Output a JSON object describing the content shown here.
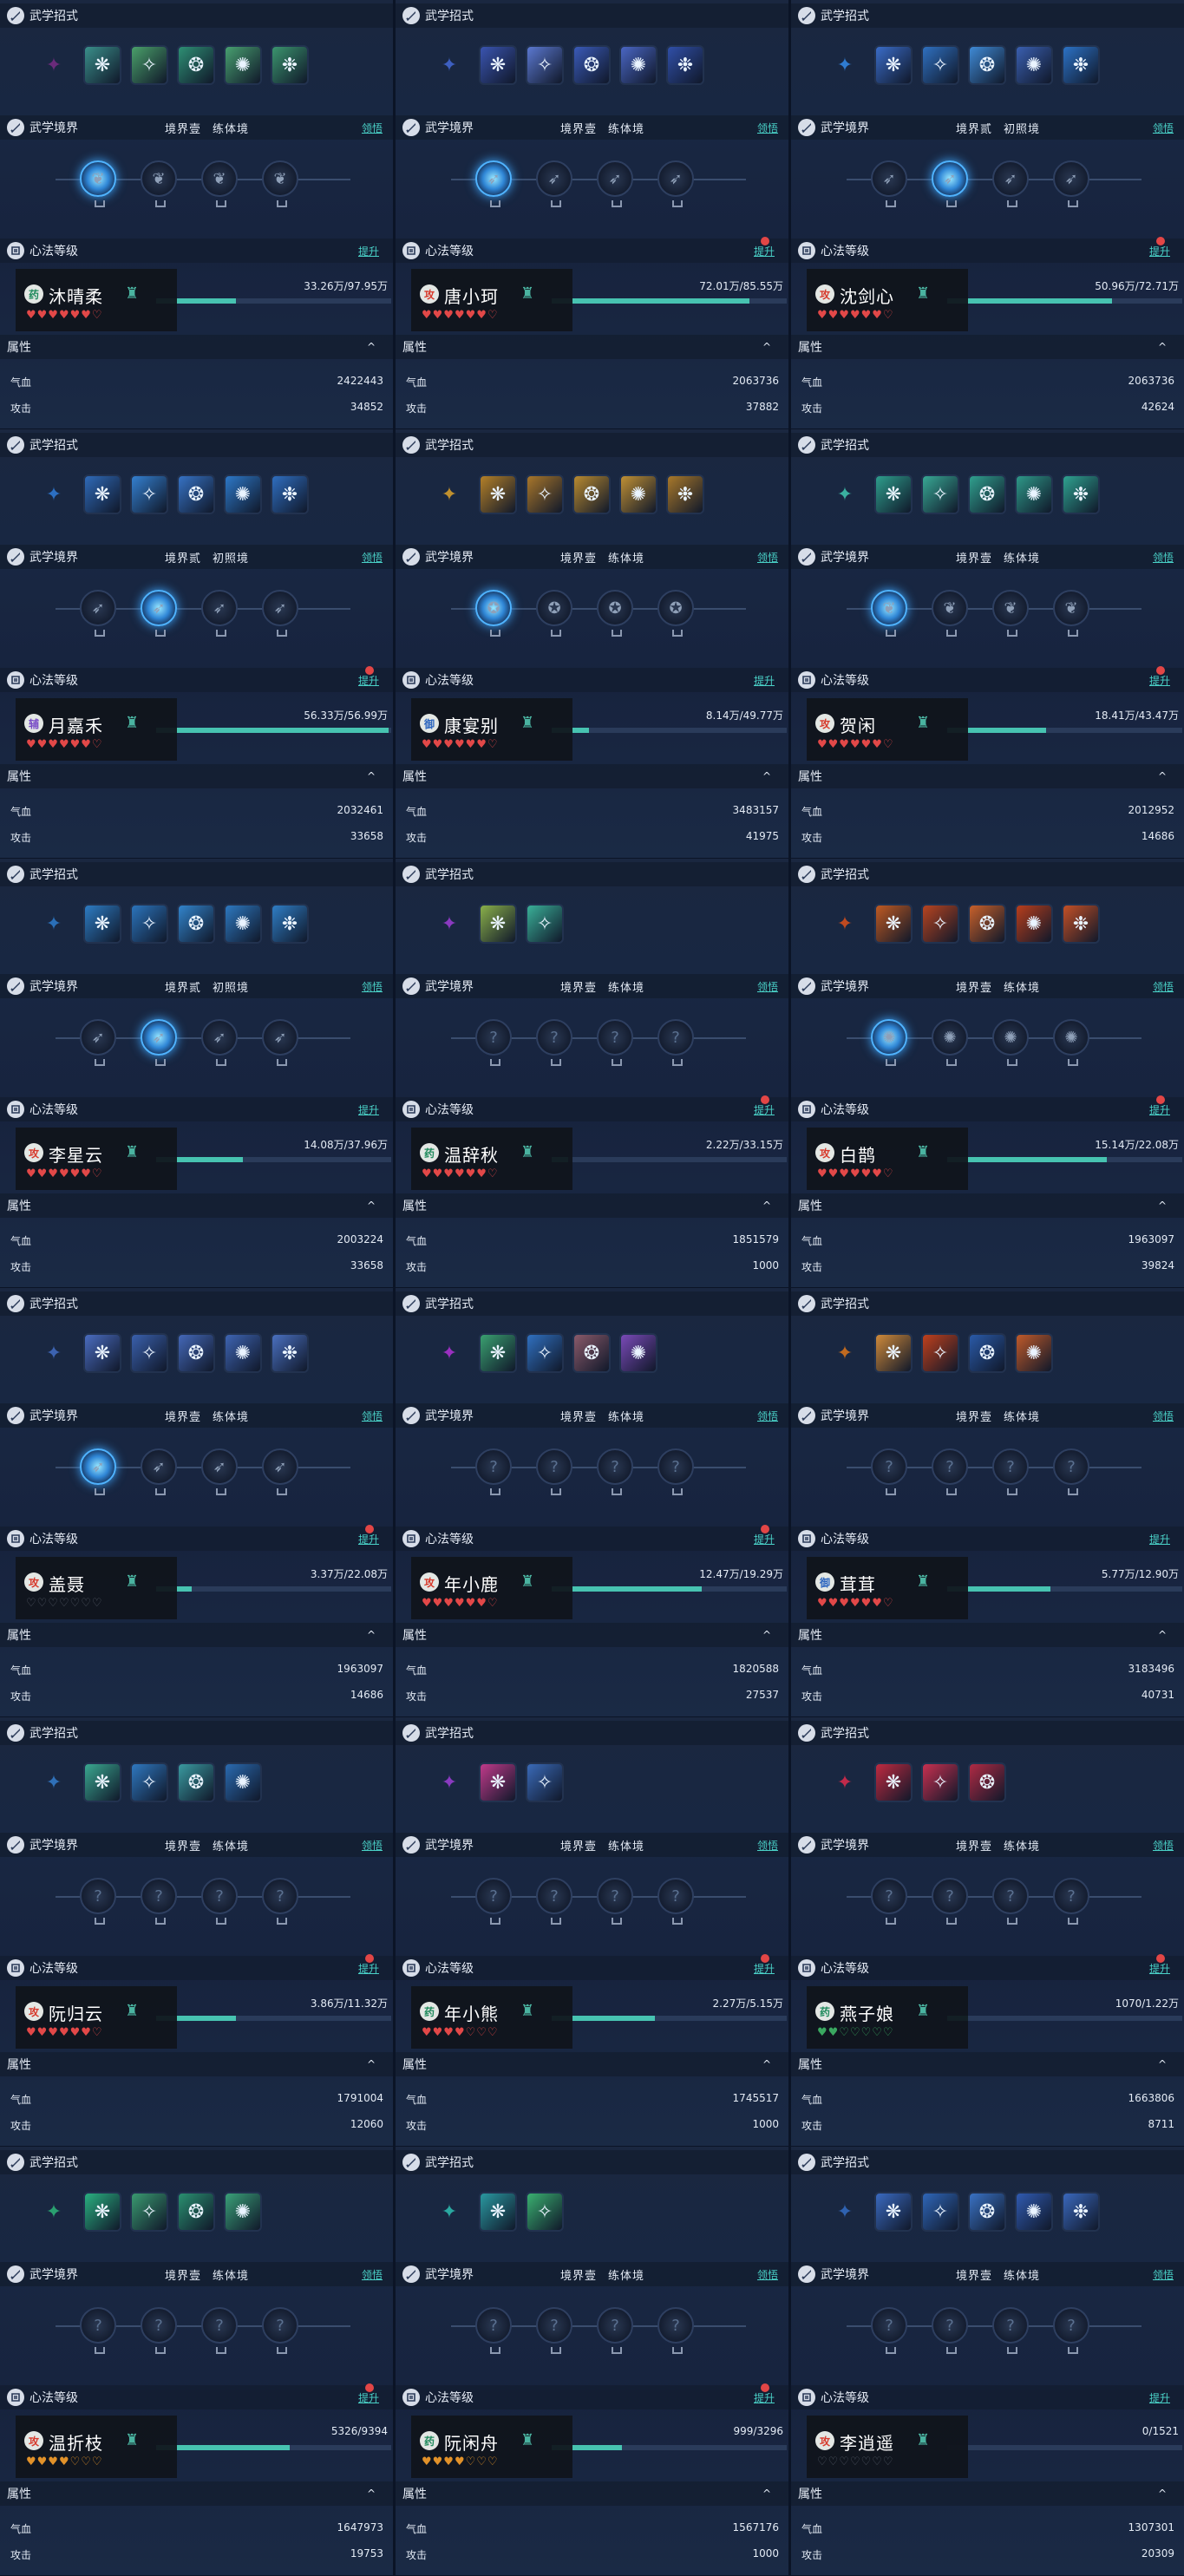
{
  "labels": {
    "skills": "武学招式",
    "realm": "武学境界",
    "heart": "心法等级",
    "attr": "属性",
    "hp": "气血",
    "atk": "攻击",
    "lead": "领悟",
    "up": "提升",
    "collapse": "^"
  },
  "panels": [
    {
      "name": "沐晴柔",
      "el": "药",
      "elc": "g",
      "prog": "33.26万/97.95万",
      "pct": 34,
      "hp": "2422443",
      "atk": "34852",
      "lv1": "境界壹",
      "lv2": "练体境",
      "dot": false,
      "skillColors": [
        "#6a2b7a",
        "#3a8f8a",
        "#4aa06a",
        "#2e8f74",
        "#48a070",
        "#3b956e"
      ],
      "nodeOn": 0,
      "nodeStyle": "green",
      "hearts": "♥♥♥♥♥♥♡",
      "hc": "#e24848"
    },
    {
      "name": "唐小珂",
      "el": "攻",
      "elc": "r",
      "prog": "72.01万/85.55万",
      "pct": 84,
      "hp": "2063736",
      "atk": "37882",
      "lv1": "境界壹",
      "lv2": "练体境",
      "dot": true,
      "skillColors": [
        "#3d5fc0",
        "#3a54b0",
        "#5b78d0",
        "#3a5ab8",
        "#4a66c4",
        "#304fa8"
      ],
      "nodeOn": 0,
      "nodeStyle": "blue",
      "hearts": "♥♥♥♥♥♥♡",
      "hc": "#e24848"
    },
    {
      "name": "沈剑心",
      "el": "攻",
      "elc": "r",
      "prog": "50.96万/72.71万",
      "pct": 70,
      "hp": "2063736",
      "atk": "42624",
      "lv1": "境界贰",
      "lv2": "初照境",
      "dot": true,
      "skillColors": [
        "#2f7bd0",
        "#3a6cc8",
        "#2f70c0",
        "#3f8ad6",
        "#3a5fb0",
        "#2c72c6"
      ],
      "nodeOn": 1,
      "nodeStyle": "blue",
      "hearts": "♥♥♥♥♥♥♡",
      "hc": "#e24848"
    },
    {
      "name": "月嘉禾",
      "el": "辅",
      "elc": "p",
      "prog": "56.33万/56.99万",
      "pct": 99,
      "hp": "2032461",
      "atk": "33658",
      "lv1": "境界贰",
      "lv2": "初照境",
      "dot": true,
      "skillColors": [
        "#2c6fc2",
        "#2f6ab8",
        "#3480d0",
        "#3672c4",
        "#2d78c8",
        "#2f6ec0"
      ],
      "nodeOn": 1,
      "nodeStyle": "blue",
      "hearts": "♥♥♥♥♥♥♡",
      "hc": "#e24848"
    },
    {
      "name": "康宴别",
      "el": "御",
      "elc": "b",
      "prog": "8.14万/49.77万",
      "pct": 16,
      "hp": "3483157",
      "atk": "41975",
      "lv1": "境界壹",
      "lv2": "练体境",
      "dot": false,
      "skillColors": [
        "#c0902e",
        "#b48028",
        "#a8762a",
        "#b88a30",
        "#c09034",
        "#a8782a"
      ],
      "nodeOn": 0,
      "nodeStyle": "gold",
      "hearts": "♥♥♥♥♥♥♡",
      "hc": "#e24848"
    },
    {
      "name": "贺闲",
      "el": "攻",
      "elc": "r",
      "prog": "18.41万/43.47万",
      "pct": 42,
      "hp": "2012952",
      "atk": "14686",
      "lv1": "境界壹",
      "lv2": "练体境",
      "dot": true,
      "skillColors": [
        "#3ab0a0",
        "#2e9e8c",
        "#38a894",
        "#30a08e",
        "#2e9888",
        "#2fa290"
      ],
      "nodeOn": 0,
      "nodeStyle": "green",
      "hearts": "♥♥♥♥♥♥♡",
      "hc": "#e24848"
    },
    {
      "name": "李星云",
      "el": "攻",
      "elc": "r",
      "prog": "14.08万/37.96万",
      "pct": 37,
      "hp": "2003224",
      "atk": "33658",
      "lv1": "境界贰",
      "lv2": "初照境",
      "dot": false,
      "skillColors": [
        "#2a6fb8",
        "#2d7cc4",
        "#2b74bc",
        "#3284cc",
        "#2d78c0",
        "#2f7ec6"
      ],
      "nodeOn": 1,
      "nodeStyle": "blue",
      "hearts": "♥♥♥♥♥♥♡",
      "hc": "#e24848"
    },
    {
      "name": "温辞秋",
      "el": "药",
      "elc": "g",
      "prog": "2.22万/33.15万",
      "pct": 7,
      "hp": "1851579",
      "atk": "1000",
      "lv1": "境界壹",
      "lv2": "练体境",
      "dot": true,
      "skillColors": [
        "#8a3ac0",
        "#8ab04a",
        "#3ab098"
      ],
      "nodeOn": -1,
      "nodeStyle": "none",
      "hearts": "♥♥♥♥♥♥♡",
      "hc": "#e24848"
    },
    {
      "name": "白鹊",
      "el": "攻",
      "elc": "r",
      "prog": "15.14万/22.08万",
      "pct": 68,
      "hp": "1963097",
      "atk": "39824",
      "lv1": "境界壹",
      "lv2": "练体境",
      "dot": true,
      "skillColors": [
        "#c04a20",
        "#c05a22",
        "#b84420",
        "#c8602a",
        "#b83e1c",
        "#c45026"
      ],
      "nodeOn": 0,
      "nodeStyle": "red",
      "hearts": "♥♥♥♥♥♥♡",
      "hc": "#e24848"
    },
    {
      "name": "盖聂",
      "el": "攻",
      "elc": "r",
      "prog": "3.37万/22.08万",
      "pct": 15,
      "hp": "1963097",
      "atk": "14686",
      "lv1": "境界壹",
      "lv2": "练体境",
      "dot": true,
      "skillColors": [
        "#3c62b0",
        "#4a6cc0",
        "#3a60ac",
        "#4468b8",
        "#3e64b2",
        "#4a70c0"
      ],
      "nodeOn": 0,
      "nodeStyle": "blue",
      "hearts": "♡♡♡♡♡♡♡",
      "hc": "#555c68"
    },
    {
      "name": "年小鹿",
      "el": "攻",
      "elc": "r",
      "prog": "12.47万/19.29万",
      "pct": 64,
      "hp": "1820588",
      "atk": "27537",
      "lv1": "境界壹",
      "lv2": "练体境",
      "dot": true,
      "skillColors": [
        "#9a30c0",
        "#3aa070",
        "#3070c0",
        "#8a5a6a",
        "#7a4ab8"
      ],
      "nodeOn": -1,
      "nodeStyle": "none",
      "hearts": "♥♥♥♥♥♥♡",
      "hc": "#e24848"
    },
    {
      "name": "茸茸",
      "el": "御",
      "elc": "b",
      "prog": "5.77万/12.90万",
      "pct": 44,
      "hp": "3183496",
      "atk": "40731",
      "lv1": "境界壹",
      "lv2": "练体境",
      "dot": false,
      "skillColors": [
        "#c06a20",
        "#d08a3a",
        "#c0401c",
        "#2a5aa8",
        "#c05a2a"
      ],
      "nodeOn": -1,
      "nodeStyle": "none",
      "hearts": "♥♥♥♥♥♥♡",
      "hc": "#e24848"
    },
    {
      "name": "阮归云",
      "el": "攻",
      "elc": "r",
      "prog": "3.86万/11.32万",
      "pct": 34,
      "hp": "1791004",
      "atk": "12060",
      "lv1": "境界壹",
      "lv2": "练体境",
      "dot": true,
      "skillColors": [
        "#2f70b8",
        "#3aa890",
        "#2f78c0",
        "#3a9aa0",
        "#2a6ab0"
      ],
      "nodeOn": -1,
      "nodeStyle": "none",
      "hearts": "♥♥♥♥♥♥♡",
      "hc": "#e24848"
    },
    {
      "name": "年小熊",
      "el": "药",
      "elc": "g",
      "prog": "2.27万/5.15万",
      "pct": 44,
      "hp": "1745517",
      "atk": "1000",
      "lv1": "境界壹",
      "lv2": "练体境",
      "dot": true,
      "skillColors": [
        "#8a3ac0",
        "#c03a8a",
        "#3a6ab8"
      ],
      "nodeOn": -1,
      "nodeStyle": "none",
      "hearts": "♥♥♥♥♡♡♡",
      "hc": "#e24848"
    },
    {
      "name": "燕子娘",
      "el": "药",
      "elc": "g",
      "prog": "1070/1.22万",
      "pct": 9,
      "hp": "1663806",
      "atk": "8711",
      "lv1": "境界壹",
      "lv2": "练体境",
      "dot": true,
      "skillColors": [
        "#c02a4a",
        "#c02a40",
        "#c83050",
        "#b02a44"
      ],
      "nodeOn": -1,
      "nodeStyle": "none",
      "hearts": "♥♥♡♡♡♡♡",
      "hc": "#3aa860"
    },
    {
      "name": "温折枝",
      "el": "攻",
      "elc": "r",
      "prog": "5326/9394",
      "pct": 57,
      "hp": "1647973",
      "atk": "19753",
      "lv1": "境界壹",
      "lv2": "练体境",
      "dot": true,
      "skillColors": [
        "#2aa070",
        "#2ab080",
        "#3a9a70",
        "#2a9070",
        "#3aa078"
      ],
      "nodeOn": -1,
      "nodeStyle": "none",
      "hearts": "♥♥♥♥♡♡♡",
      "hc": "#e2922a"
    },
    {
      "name": "阮闲舟",
      "el": "药",
      "elc": "g",
      "prog": "999/3296",
      "pct": 30,
      "hp": "1567176",
      "atk": "1000",
      "lv1": "境界壹",
      "lv2": "练体境",
      "dot": true,
      "skillColors": [
        "#2aa8a0",
        "#2a98a0",
        "#3ab070"
      ],
      "nodeOn": -1,
      "nodeStyle": "none",
      "hearts": "♥♥♥♥♡♡♡",
      "hc": "#e2922a"
    },
    {
      "name": "李逍遥",
      "el": "攻",
      "elc": "r",
      "prog": "0/1521",
      "pct": 0,
      "hp": "1307301",
      "atk": "20309",
      "lv1": "境界壹",
      "lv2": "练体境",
      "dot": false,
      "skillColors": [
        "#2f62b0",
        "#3a6ac0",
        "#2f66b8",
        "#3a72c4",
        "#305ab0",
        "#3a68bc"
      ],
      "nodeOn": -1,
      "nodeStyle": "none",
      "hearts": "♡♡♡♡♡♡♡",
      "hc": "#555c68"
    }
  ]
}
